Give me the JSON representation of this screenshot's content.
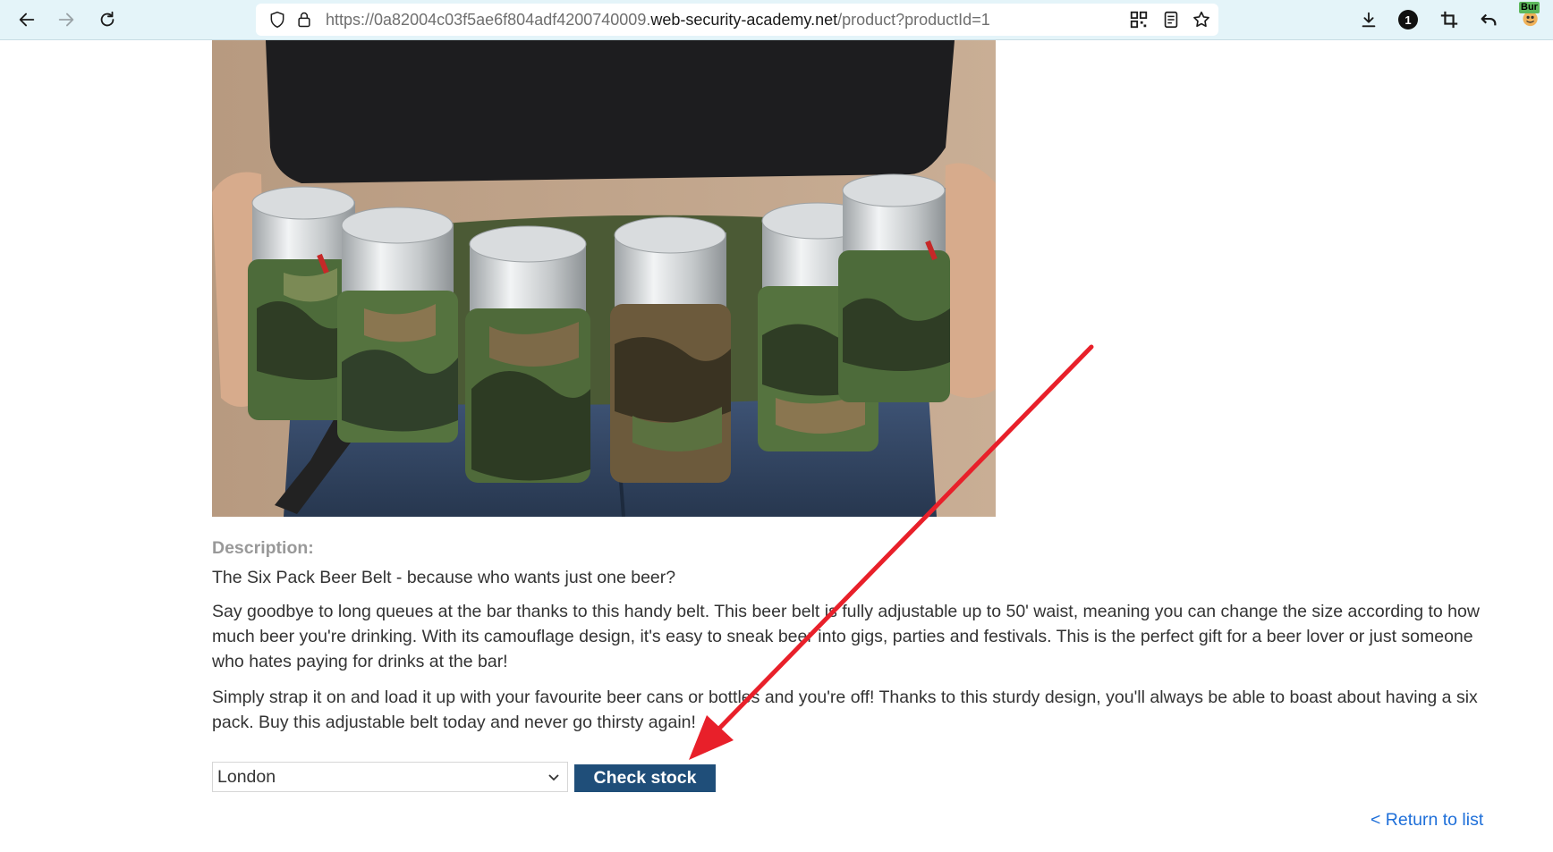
{
  "browser": {
    "url_prefix": "https://0a82004c03f5ae6f804adf4200740009.",
    "url_domain": "web-security-academy.net",
    "url_path": "/product?productId=1",
    "notification_count": "1",
    "extension_label": "Bur"
  },
  "product": {
    "image_alt": "Six pack beer belt worn around waist with camouflage can holders"
  },
  "description": {
    "label": "Description:",
    "paragraphs": [
      "The Six Pack Beer Belt - because who wants just one beer?",
      "Say goodbye to long queues at the bar thanks to this handy belt. This beer belt is fully adjustable up to 50' waist, meaning you can change the size according to how much beer you're drinking. With its camouflage design, it's easy to sneak beer into gigs, parties and festivals. This is the perfect gift for a beer lover or just someone who hates paying for drinks at the bar!",
      "Simply strap it on and load it up with your favourite beer cans or bottles and you're off! Thanks to this sturdy design, you'll always be able to boast about having a six pack. Buy this adjustable belt today and never go thirsty again!"
    ]
  },
  "stock_form": {
    "selected_store": "London",
    "check_button": "Check stock"
  },
  "nav": {
    "return_link": "< Return to list"
  },
  "colors": {
    "toolbar_bg": "#e4f4f9",
    "button_bg": "#1f4e79",
    "link": "#1e6fd9",
    "annotation_arrow": "#e8202a"
  }
}
